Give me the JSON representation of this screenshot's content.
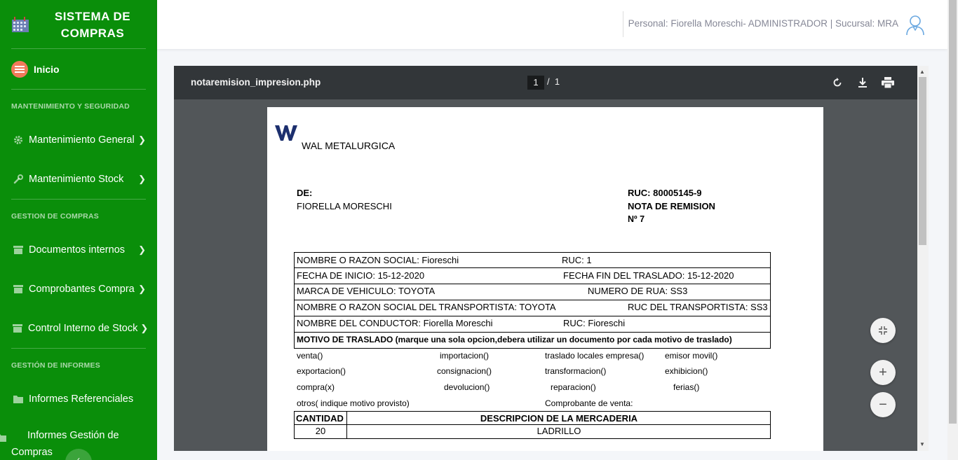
{
  "sidebar": {
    "brand_line1": "SISTEMA DE",
    "brand_line2": "COMPRAS",
    "home_label": "Inicio",
    "section_security": "MANTENIMIENTO Y SEGURIDAD",
    "item_general": "Mantenimiento General",
    "item_stock": "Mantenimiento Stock",
    "section_purchases": "GESTION DE COMPRAS",
    "item_internal_docs": "Documentos internos",
    "item_receipts": "Comprobantes Compra",
    "item_stock_control": "Control Interno de Stock",
    "section_reports": "GESTIÓN DE INFORMES",
    "item_ref_reports": "Informes Referenciales",
    "item_mgmt_reports": "Informes Gestión de Compras"
  },
  "topbar": {
    "user_info": "Personal: Fiorella Moreschi- ADMINISTRADOR | Sucursal: MRA"
  },
  "viewer": {
    "filename": "notaremision_impresion.php",
    "current_page": "1",
    "page_separator": "/",
    "total_pages": "1"
  },
  "document": {
    "company": "WAL METALURGICA",
    "from_label": "DE:",
    "from_name": "FIORELLA MORESCHI",
    "ruc": "RUC: 80005145-9",
    "doc_type": "NOTA DE REMISION",
    "doc_number": "Nº 7",
    "row1_left": "NOMBRE O RAZON SOCIAL: Fioreschi",
    "row1_right": "RUC: 1",
    "row2_left": "FECHA DE INICIO: 15-12-2020",
    "row2_right": "FECHA FIN DEL TRASLADO: 15-12-2020",
    "row3_left": "MARCA DE VEHICULO: TOYOTA",
    "row3_right": "NUMERO DE RUA: SS3",
    "row4_left": "NOMBRE O RAZON SOCIAL DEL TRANSPORTISTA: TOYOTA",
    "row4_right": "RUC DEL TRANSPORTISTA: SS3",
    "row5_left": "NOMBRE DEL CONDUCTOR: Fiorella Moreschi",
    "row5_right": "RUC: Fioreschi",
    "motive_header": "MOTIVO DE TRASLADO  (marque una sola opcion,debera utilizar un documento por cada motivo de traslado)",
    "opt_venta": "venta()",
    "opt_importacion": "importacion()",
    "opt_traslado": "traslado locales empresa()",
    "opt_emisor": "emisor movil()",
    "opt_exportacion": "exportacion()",
    "opt_consignacion": "consignacion()",
    "opt_transformacion": "transformacion()",
    "opt_exhibicion": "exhibicion()",
    "opt_compra": "compra(x)",
    "opt_devolucion": "devolucion()",
    "opt_reparacion": "reparacion()",
    "opt_ferias": "ferias()",
    "opt_otros": "otros( indique motivo provisto)",
    "opt_comprobante": "Comprobante de venta:",
    "table_qty_header": "CANTIDAD",
    "table_desc_header": "DESCRIPCION DE LA MERCADERIA",
    "item_qty": "20",
    "item_desc": "LADRILLO"
  },
  "colors": {
    "sidebar_bg": "#0a8e0a",
    "viewer_bar": "#323639",
    "viewer_bg": "#525659"
  }
}
